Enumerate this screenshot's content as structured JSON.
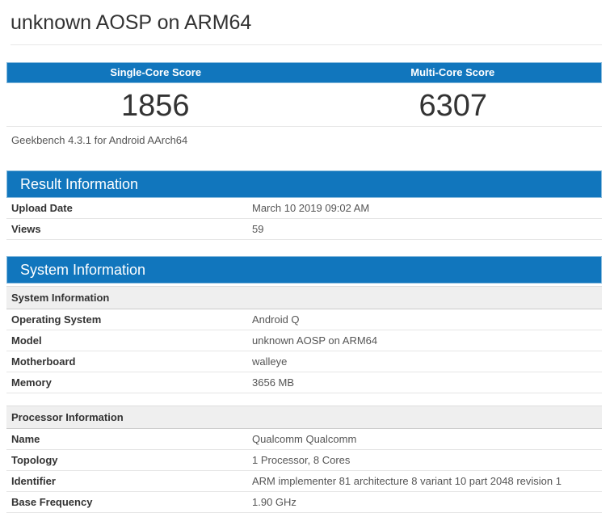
{
  "page": {
    "title": "unknown AOSP on ARM64"
  },
  "colors": {
    "header_blue": "#1176bd",
    "header_blue_border": "#85b9dc",
    "subheader_gray": "#efefef"
  },
  "scores": {
    "single_core_label": "Single-Core Score",
    "single_core_value": "1856",
    "multi_core_label": "Multi-Core Score",
    "multi_core_value": "6307",
    "caption": "Geekbench 4.3.1 for Android AArch64"
  },
  "result_information": {
    "title": "Result Information",
    "rows": [
      {
        "label": "Upload Date",
        "value": "March 10 2019 09:02 AM"
      },
      {
        "label": "Views",
        "value": "59"
      }
    ]
  },
  "system_information": {
    "title": "System Information",
    "system_subsection": {
      "title": "System Information",
      "rows": [
        {
          "label": "Operating System",
          "value": "Android Q"
        },
        {
          "label": "Model",
          "value": "unknown AOSP on ARM64"
        },
        {
          "label": "Motherboard",
          "value": "walleye"
        },
        {
          "label": "Memory",
          "value": "3656 MB"
        }
      ]
    },
    "processor_subsection": {
      "title": "Processor Information",
      "rows": [
        {
          "label": "Name",
          "value": "Qualcomm Qualcomm"
        },
        {
          "label": "Topology",
          "value": "1 Processor, 8 Cores"
        },
        {
          "label": "Identifier",
          "value": "ARM implementer 81 architecture 8 variant 10 part 2048 revision 1"
        },
        {
          "label": "Base Frequency",
          "value": "1.90 GHz"
        }
      ]
    }
  }
}
